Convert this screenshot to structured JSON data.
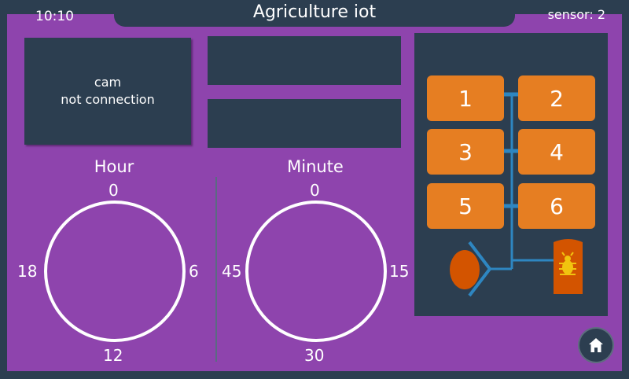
{
  "header": {
    "time": "10:10",
    "title": "Agriculture iot",
    "sensor": "sensor: 2"
  },
  "camera": {
    "line1": "cam",
    "line2": "not connection"
  },
  "hour_dial": {
    "label": "Hour",
    "top": "0",
    "right": "6",
    "bottom": "12",
    "left": "18"
  },
  "minute_dial": {
    "label": "Minute",
    "top": "0",
    "right": "15",
    "bottom": "30",
    "left": "45"
  },
  "zones": [
    "1",
    "2",
    "3",
    "4",
    "5",
    "6"
  ],
  "colors": {
    "background": "#8e44ad",
    "panel": "#2c3e50",
    "zone": "#e67e22",
    "pipe": "#2e86c1",
    "tank": "#d35400",
    "bug": "#f1c40f"
  },
  "icons": {
    "home": "home-icon",
    "bug": "bug-icon"
  }
}
